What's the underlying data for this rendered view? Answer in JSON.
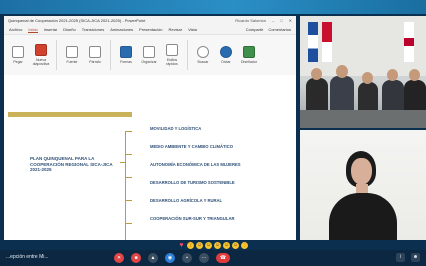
{
  "window": {
    "title": "Quinquenal de Cooperación 2021-2025 (SICA-JICA 2021-2025) - PowerPoint",
    "user": "Ricardo Salomón"
  },
  "ppt_menu": {
    "tabs": [
      "Archivo",
      "Inicio",
      "Insertar",
      "Diseño",
      "Transiciones",
      "Animaciones",
      "Presentación",
      "Revisar",
      "Vista"
    ],
    "active_index": 1,
    "right_items": [
      "Compartir",
      "Comentarios"
    ]
  },
  "ribbon": {
    "groups": [
      {
        "label": "Pegar",
        "icon": "paste-icon",
        "color": "plain"
      },
      {
        "label": "Nueva diapositiva",
        "icon": "new-slide-icon",
        "color": "red"
      },
      {
        "label": "Fuente",
        "icon": "font-icon",
        "color": "plain"
      },
      {
        "label": "Párrafo",
        "icon": "paragraph-icon",
        "color": "plain"
      },
      {
        "label": "Formas",
        "icon": "shapes-icon",
        "color": "blue"
      },
      {
        "label": "Organizar",
        "icon": "arrange-icon",
        "color": "plain"
      },
      {
        "label": "Estilos rápidos",
        "icon": "quick-styles-icon",
        "color": "plain"
      },
      {
        "label": "Buscar",
        "icon": "find-icon",
        "color": "plain"
      },
      {
        "label": "Dictar",
        "icon": "dictate-icon",
        "color": "blue"
      },
      {
        "label": "Diseñador",
        "icon": "designer-icon",
        "color": "green"
      }
    ]
  },
  "slide": {
    "plan_title": "PLAN QUINQUENAL PARA LA COOPERACIÓN REGIONAL SICA-JICA 2021-2025",
    "areas": [
      "MOVILIDAD Y LOGÍSTICA",
      "MEDIO AMBIENTE Y CAMBIO CLIMÁTICO",
      "AUTONOMÍA ECONÓMICA DE LAS MUJERES",
      "DESARROLLO DE TURISMO SOSTENIBLE",
      "DESARROLLO AGRÍCOLA Y RURAL",
      "COOPERACIÓN SUR-SUR Y TRIANGULAR"
    ]
  },
  "meeting": {
    "name": "...epción entre Mi...",
    "reactions": [
      "heart",
      "thumbs-up",
      "clap",
      "laugh",
      "surprised",
      "party",
      "thumbs-up-2",
      "hand"
    ],
    "controls": [
      "mic",
      "camera",
      "share",
      "present",
      "chat",
      "more",
      "leave"
    ],
    "colors": {
      "bar": "#0b2741",
      "leave": "#e23a3a",
      "active": "#2d7fd6"
    }
  }
}
